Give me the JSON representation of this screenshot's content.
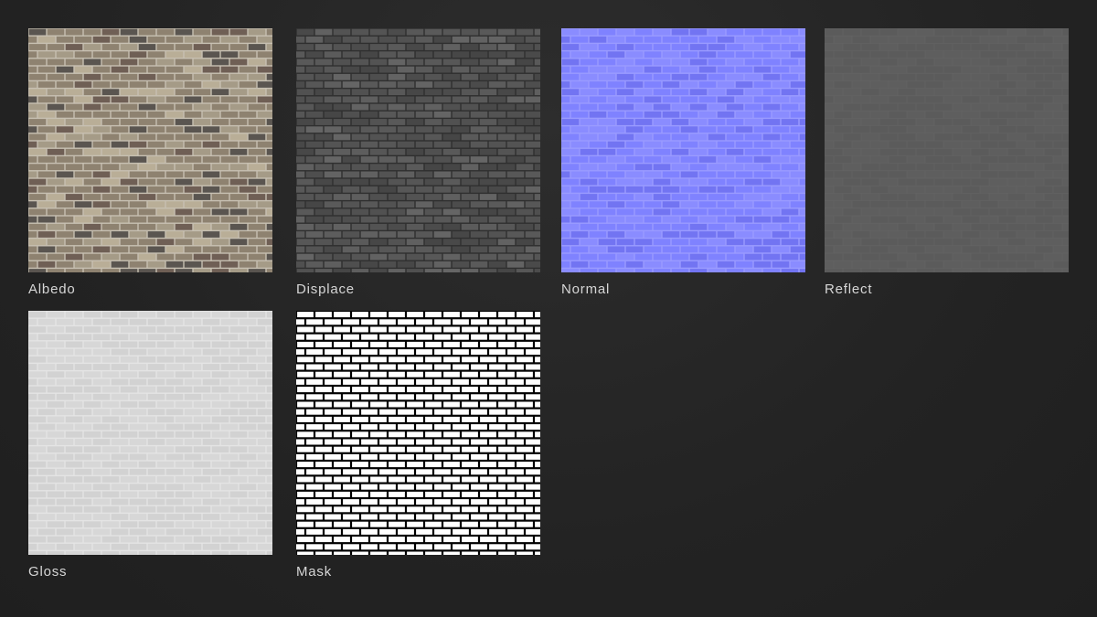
{
  "maps": [
    {
      "label": "Albedo",
      "base_color": "#8e8270",
      "mortar_color": "#c7c0b2",
      "accent_colors": [
        "#6f5f55",
        "#a59b87",
        "#5a5550",
        "#b9ae97"
      ]
    },
    {
      "label": "Displace",
      "base_color": "#5a5a5a",
      "mortar_color": "#2f2f2f",
      "accent_colors": [
        "#666666",
        "#4d4d4d"
      ]
    },
    {
      "label": "Normal",
      "base_color": "#7f82ff",
      "mortar_color": "#9a9bff",
      "accent_colors": [
        "#7274f2",
        "#8a8cff"
      ]
    },
    {
      "label": "Reflect",
      "base_color": "#5e5e5e",
      "mortar_color": "#6a6a6a",
      "accent_colors": [
        "#585858"
      ]
    },
    {
      "label": "Gloss",
      "base_color": "#d8d8d8",
      "mortar_color": "#ececec",
      "accent_colors": [
        "#cfcfcf"
      ]
    },
    {
      "label": "Mask",
      "base_color": "#ffffff",
      "mortar_color": "#000000",
      "accent_colors": []
    }
  ]
}
